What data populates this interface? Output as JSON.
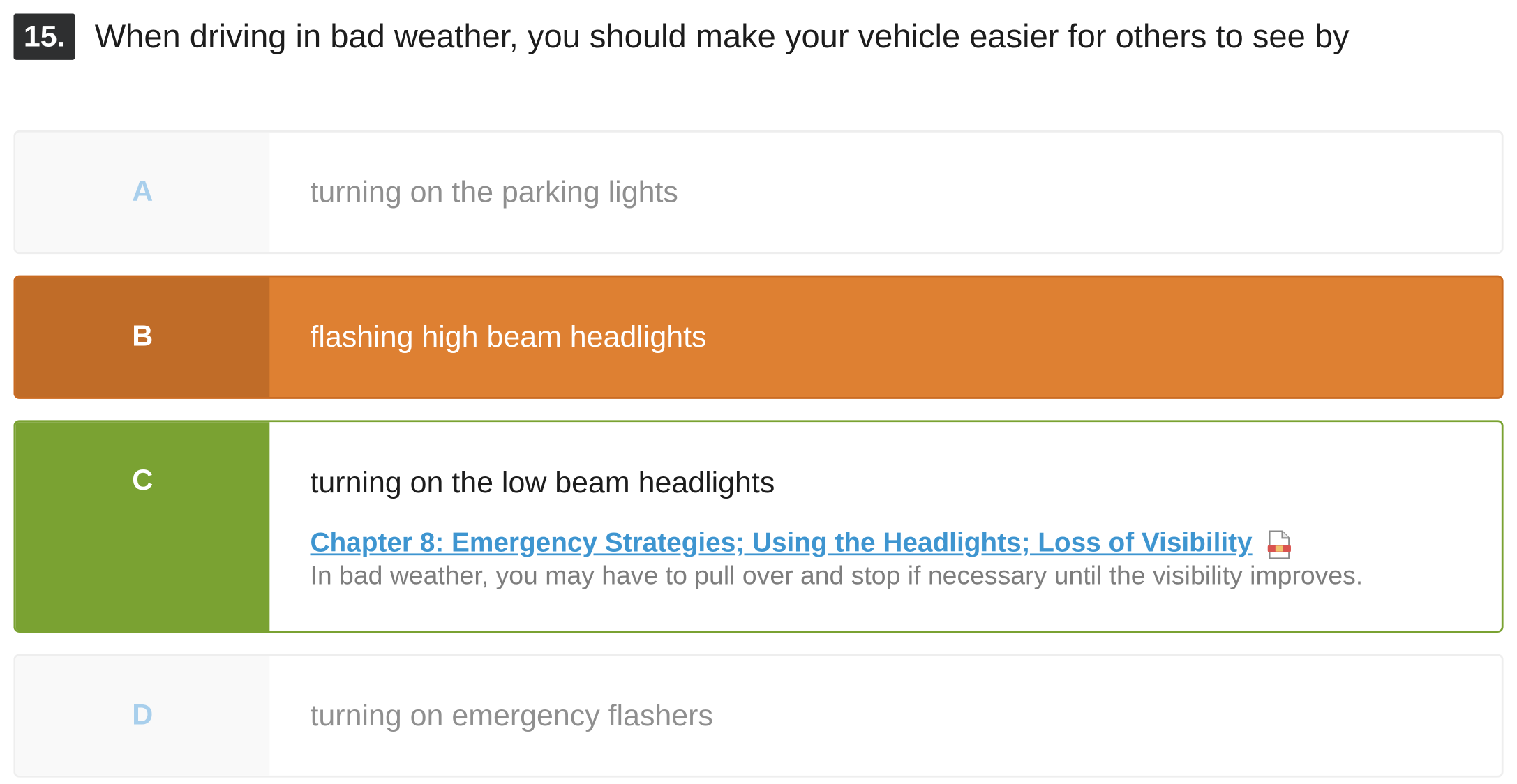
{
  "question": {
    "number": "15.",
    "text": "When driving in bad weather, you should make your vehicle easier for others to see by"
  },
  "options": [
    {
      "letter": "A",
      "text": "turning on the parking lights",
      "state": "neutral"
    },
    {
      "letter": "B",
      "text": "flashing high beam headlights",
      "state": "selected-wrong"
    },
    {
      "letter": "C",
      "text": "turning on the low beam headlights",
      "state": "correct",
      "reference_link": "Chapter 8: Emergency Strategies; Using the Headlights; Loss of Visibility",
      "reference_icon": "document-icon",
      "explanation": "In bad weather, you may have to pull over and stop if necessary until the visibility improves."
    },
    {
      "letter": "D",
      "text": "turning on emergency flashers",
      "state": "neutral"
    }
  ],
  "colors": {
    "wrong": "#de8032",
    "wrong_letter_bg": "#c06c28",
    "correct": "#7aa232",
    "link": "#3e95d0",
    "neutral_letter": "#a8cfec"
  }
}
